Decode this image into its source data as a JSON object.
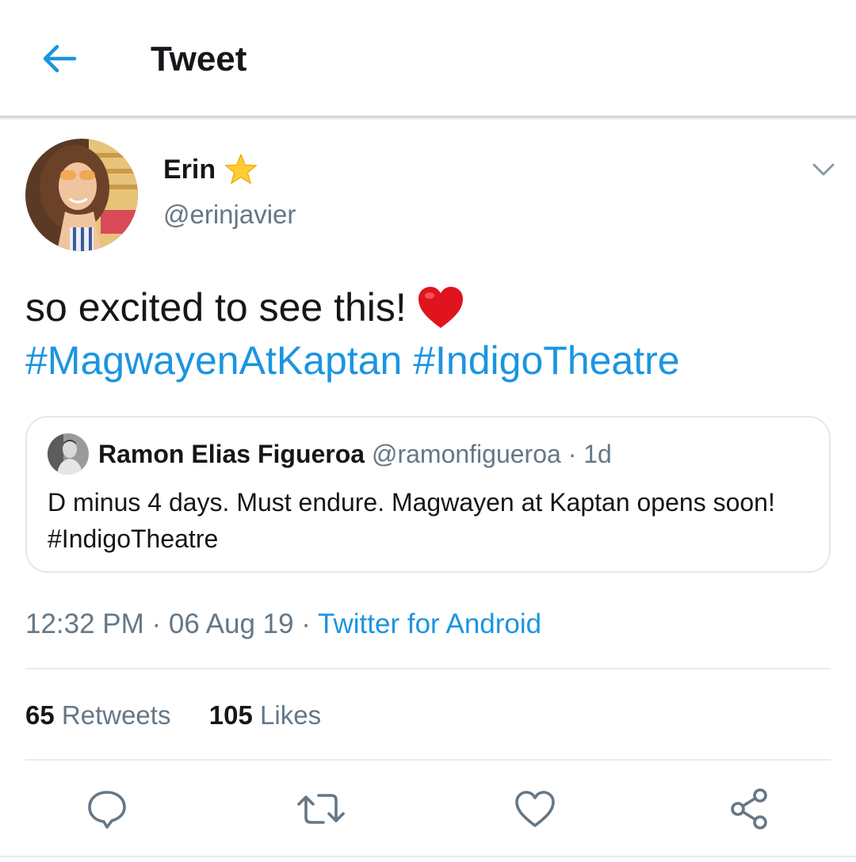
{
  "header": {
    "title": "Tweet",
    "back_icon": "arrow-left-icon"
  },
  "tweet": {
    "author": {
      "name": "Erin",
      "badge_icon": "star-icon",
      "handle": "@erinjavier"
    },
    "text": "so excited to see this!",
    "emoji": "heart-emoji",
    "hashtags": [
      "#MagwayenAtKaptan",
      "#IndigoTheatre"
    ],
    "timestamp": "12:32 PM · 06 Aug 19 · ",
    "source": "Twitter for Android",
    "stats": {
      "retweets_count": "65",
      "retweets_label": "Retweets",
      "likes_count": "105",
      "likes_label": "Likes"
    }
  },
  "quoted": {
    "name": "Ramon Elias Figueroa",
    "handle": "@ramonfigueroa",
    "separator": "·",
    "time": "1d",
    "text": "D minus 4 days. Must endure. Magwayen at Kaptan opens soon! #IndigoTheatre"
  },
  "actions": [
    "reply-icon",
    "retweet-icon",
    "like-icon",
    "share-icon"
  ],
  "colors": {
    "accent": "#1b95e0",
    "text_primary": "#14171a",
    "text_secondary": "#657786",
    "border": "#e1e8ed",
    "star": "#ffcc33",
    "heart": "#e0141e"
  }
}
